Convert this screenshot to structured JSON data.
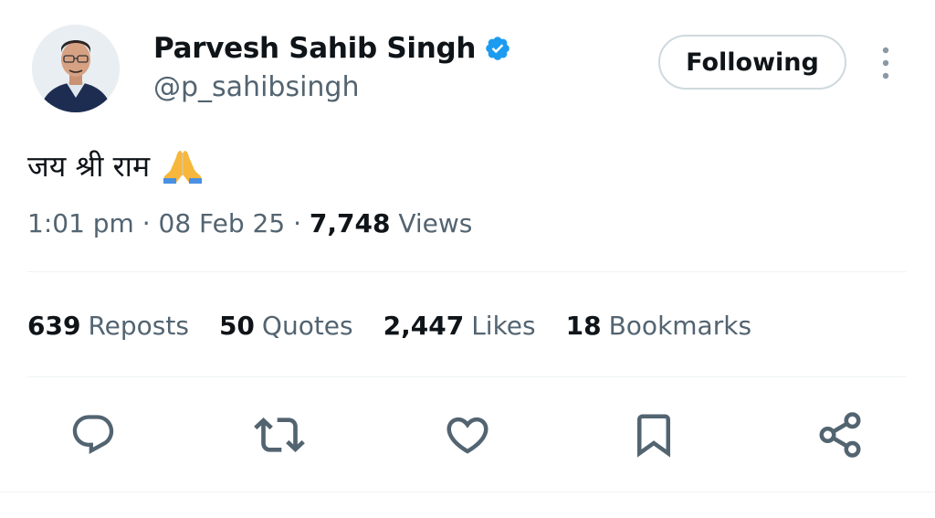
{
  "author": {
    "name": "Parvesh Sahib Singh",
    "handle": "@p_sahibsingh",
    "verified": true
  },
  "follow_button": {
    "label": "Following"
  },
  "tweet": {
    "text": "जय श्री राम",
    "emoji": "folded-hands-emoji"
  },
  "meta": {
    "time": "1:01 pm",
    "sep1": " · ",
    "date": "08 Feb 25",
    "sep2": " · ",
    "views_count": "7,748",
    "views_label": " Views"
  },
  "stats": [
    {
      "count": "639",
      "label": "Reposts"
    },
    {
      "count": "50",
      "label": "Quotes"
    },
    {
      "count": "2,447",
      "label": "Likes"
    },
    {
      "count": "18",
      "label": "Bookmarks"
    }
  ],
  "actions": [
    {
      "icon": "reply-icon"
    },
    {
      "icon": "repost-icon"
    },
    {
      "icon": "like-icon"
    },
    {
      "icon": "bookmark-icon"
    },
    {
      "icon": "share-icon"
    }
  ],
  "colors": {
    "text": "#0f1419",
    "secondary": "#536471",
    "verified": "#1d9bf0",
    "border": "#cfd9de",
    "divider": "#eff3f4"
  }
}
